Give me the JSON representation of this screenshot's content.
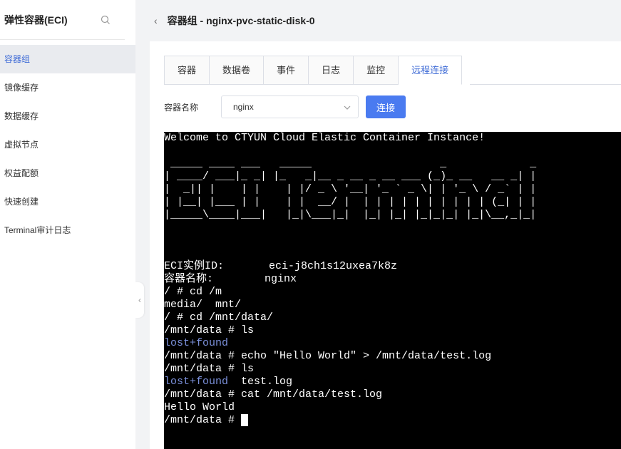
{
  "sidebar": {
    "title": "弹性容器(ECI)",
    "items": [
      {
        "label": "容器组",
        "active": true
      },
      {
        "label": "镜像缓存",
        "active": false
      },
      {
        "label": "数据缓存",
        "active": false
      },
      {
        "label": "虚拟节点",
        "active": false
      },
      {
        "label": "权益配额",
        "active": false
      },
      {
        "label": "快速创建",
        "active": false
      },
      {
        "label": "Terminal审计日志",
        "active": false
      }
    ]
  },
  "header": {
    "title": "容器组 - nginx-pvc-static-disk-0"
  },
  "tabs": [
    {
      "label": "容器",
      "active": false
    },
    {
      "label": "数据卷",
      "active": false
    },
    {
      "label": "事件",
      "active": false
    },
    {
      "label": "日志",
      "active": false
    },
    {
      "label": "监控",
      "active": false
    },
    {
      "label": "远程连接",
      "active": true
    }
  ],
  "container_select": {
    "label": "容器名称",
    "value": "nginx",
    "connect_label": "连接"
  },
  "terminal": {
    "lines": [
      {
        "text": "Welcome to CTYUN Cloud Elastic Container Instance!",
        "style": "normal"
      },
      {
        "text": "",
        "style": "normal"
      },
      {
        "text": " _____ ____ ___   _____                    _             _ ",
        "style": "normal"
      },
      {
        "text": "| ____/ ___|_ _| |_   _|__ _ __ _ __ ___ (_)_ __   __ _| |",
        "style": "normal"
      },
      {
        "text": "|  _|| |    | |    | |/ _ \\ '__| '_ ` _ \\| | '_ \\ / _` | |",
        "style": "normal"
      },
      {
        "text": "| |__| |___ | |    | |  __/ |  | | | | | | | | | | (_| | |",
        "style": "normal"
      },
      {
        "text": "|_____\\____|___|   |_|\\___|_|  |_| |_| |_|_|_| |_|\\__,_|_|",
        "style": "normal"
      },
      {
        "text": "",
        "style": "normal"
      },
      {
        "text": "",
        "style": "normal"
      },
      {
        "text": "",
        "style": "normal"
      },
      {
        "text": "ECI实例ID:       eci-j8ch1s12uxea7k8z",
        "style": "normal"
      },
      {
        "text": "容器名称:        nginx",
        "style": "normal"
      },
      {
        "text": "/ # cd /m",
        "style": "normal"
      },
      {
        "text": "media/  mnt/",
        "style": "normal"
      },
      {
        "text": "/ # cd /mnt/data/",
        "style": "normal"
      },
      {
        "text": "/mnt/data # ls",
        "style": "normal"
      },
      {
        "text": "lost+found",
        "style": "link"
      },
      {
        "text": "/mnt/data # echo \"Hello World\" > /mnt/data/test.log",
        "style": "normal"
      },
      {
        "text": "/mnt/data # ls",
        "style": "normal"
      },
      {
        "text": "lost+found",
        "style": "link",
        "suffix": "  test.log"
      },
      {
        "text": "/mnt/data # cat /mnt/data/test.log",
        "style": "normal"
      },
      {
        "text": "Hello World",
        "style": "normal"
      }
    ],
    "prompt": "/mnt/data # "
  },
  "icons": {
    "search": "search-icon",
    "back": "chevron-left-icon",
    "select_arrow": "chevron-down-icon",
    "collapse": "chevron-left-icon"
  },
  "colors": {
    "accent": "#4a7bf0",
    "active_text": "#3d6ad6",
    "terminal_bg": "#000000",
    "terminal_link": "#7a8fd9"
  }
}
